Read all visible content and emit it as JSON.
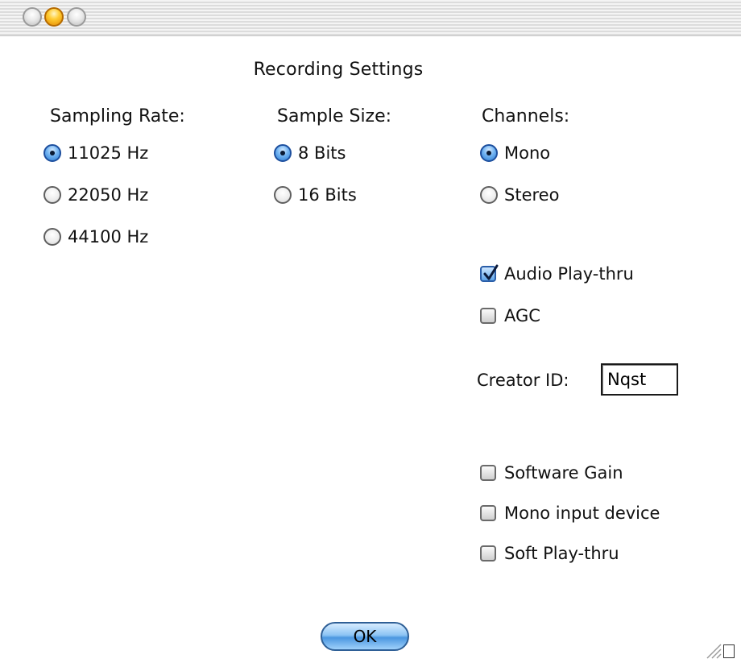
{
  "window": {
    "title": "Recording Settings",
    "traffic_lights": [
      "close-button",
      "minimize-button",
      "zoom-button"
    ]
  },
  "sampling_rate": {
    "label": "Sampling Rate:",
    "options": [
      "11025 Hz",
      "22050 Hz",
      "44100 Hz"
    ],
    "selected": "11025 Hz"
  },
  "sample_size": {
    "label": "Sample Size:",
    "options": [
      "8 Bits",
      "16 Bits"
    ],
    "selected": "8 Bits"
  },
  "channels": {
    "label": "Channels:",
    "options": [
      "Mono",
      "Stereo"
    ],
    "selected": "Mono"
  },
  "toggles": {
    "audio_play_thru": {
      "label": "Audio Play-thru",
      "checked": true
    },
    "agc": {
      "label": "AGC",
      "checked": false
    }
  },
  "creator_id": {
    "label": "Creator ID:",
    "value": "Nqst"
  },
  "options": {
    "software_gain": {
      "label": "Software Gain",
      "checked": false
    },
    "mono_input_device": {
      "label": "Mono input device",
      "checked": false
    },
    "soft_play_thru": {
      "label": "Soft Play-thru",
      "checked": false
    }
  },
  "buttons": {
    "ok_label": "OK"
  },
  "colors": {
    "accent": "#4b97e0",
    "traffic_light_active": "#ffcc33"
  }
}
